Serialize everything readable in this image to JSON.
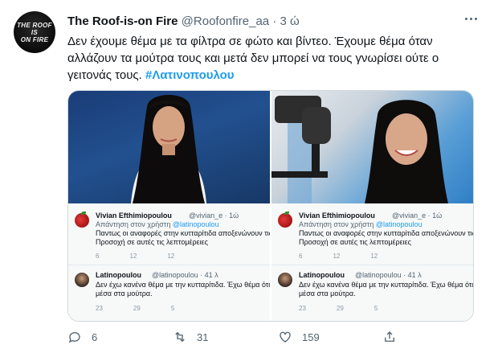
{
  "tweet": {
    "author_name": "The Roof-is-on Fire",
    "author_handle": "@Roofonfire_aa",
    "separator": "·",
    "time": "3 ώ",
    "avatar_lines": [
      "THE ROOF",
      "IS",
      "ON FIRE"
    ],
    "text": "Δεν έχουμε θέμα με τα φίλτρα σε φώτο και βίντεο. Έχουμε θέμα όταν αλλάζουν τα μούτρα τους και μετά δεν μπορεί να τους γνωρίσει ούτε ο γειτονάς τους.",
    "hashtag": "#Λατινοπουλου",
    "actions": {
      "replies": "6",
      "retweets": "31",
      "likes": "159"
    }
  },
  "screenshot": {
    "reply1": {
      "name": "Vivian Efthimiopoulou",
      "handle": "@vivian_e · 1ώ",
      "reply_to_prefix": "Απάντηση στον χρήστη",
      "reply_to_handle": "@latinopoulou",
      "line1": "Παντως οι αναφορές στην κυτταρίτιδα αποξενώνουν τις ψ",
      "line2": "Προσοχή σε αυτές τις λεπτομέρειες",
      "counts": [
        "6",
        "12",
        "12"
      ]
    },
    "reply2": {
      "name": "Latinopoulou",
      "handle": "@latinopoulou · 41 λ",
      "line1": "Δεν έχω κανένα θέμα με την κυτταρίτιδα. Έχω θέμα όταν μ",
      "line2": "μέσα στα μούτρα.",
      "counts": [
        "23",
        "29",
        "5"
      ]
    }
  },
  "colors": {
    "accent": "#1d9bf0",
    "secondary_text": "#536471",
    "border": "#cfd9de"
  },
  "icons": [
    "more-icon",
    "reply-icon",
    "retweet-icon",
    "like-icon",
    "share-icon"
  ]
}
